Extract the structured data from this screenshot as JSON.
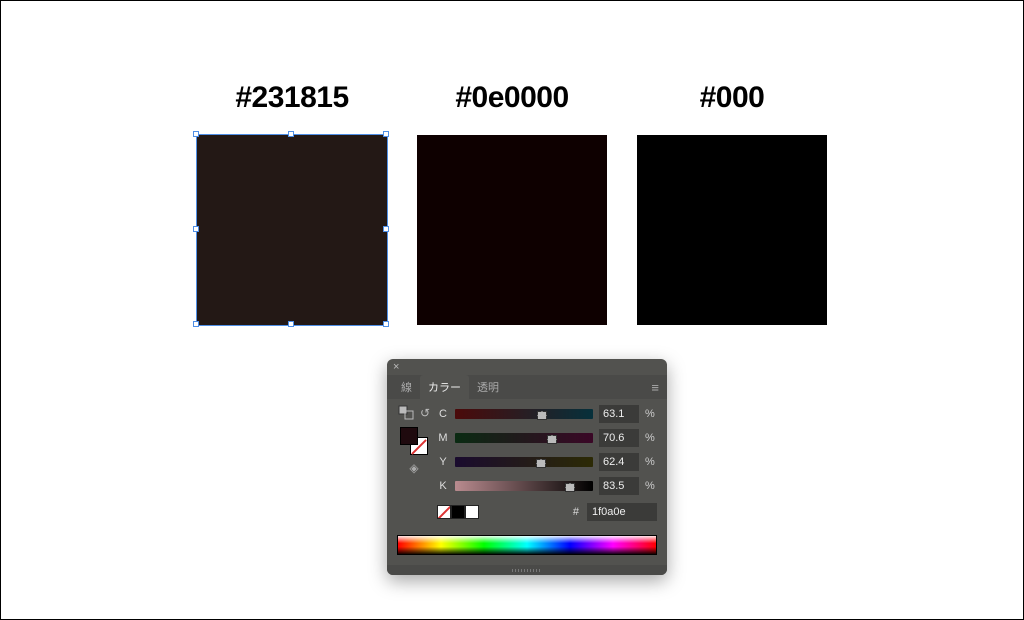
{
  "swatches": [
    {
      "label": "#231815",
      "hex": "#231815",
      "selected": true
    },
    {
      "label": "#0e0000",
      "hex": "#0e0000",
      "selected": false
    },
    {
      "label": "#000",
      "hex": "#000000",
      "selected": false
    }
  ],
  "panel": {
    "tabs": {
      "stroke": "線",
      "color": "カラー",
      "opacity": "透明"
    },
    "active_tab": "color",
    "channels": {
      "C": {
        "label": "C",
        "value": "63.1",
        "pct": 63.1
      },
      "M": {
        "label": "M",
        "value": "70.6",
        "pct": 70.6
      },
      "Y": {
        "label": "Y",
        "value": "62.4",
        "pct": 62.4
      },
      "K": {
        "label": "K",
        "value": "83.5",
        "pct": 83.5
      }
    },
    "percent_symbol": "%",
    "hash_symbol": "#",
    "hex_value": "1f0a0e",
    "current_fill": "#1f0a0e"
  }
}
